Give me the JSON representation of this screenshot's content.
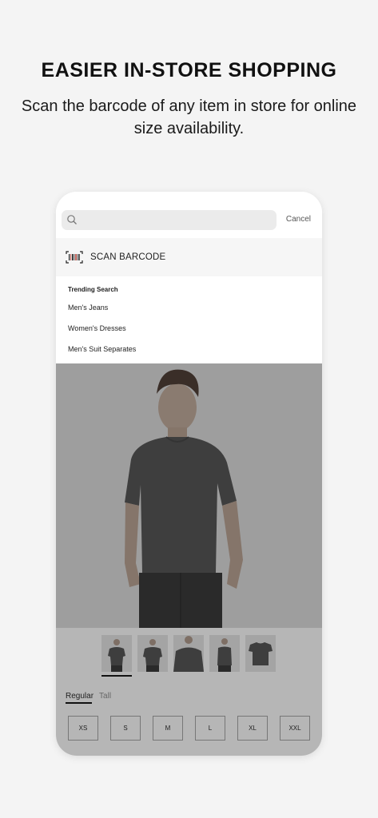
{
  "promo": {
    "headline": "EASIER IN-STORE SHOPPING",
    "subline": "Scan the barcode of any item in store for online size availability."
  },
  "search": {
    "placeholder": "",
    "cancel_label": "Cancel"
  },
  "scan": {
    "label": "SCAN BARCODE"
  },
  "trending": {
    "title": "Trending Search",
    "items": [
      "Men's Jeans",
      "Women's Dresses",
      "Men's Suit Separates"
    ]
  },
  "product": {
    "fit_tabs": [
      "Regular",
      "Tall"
    ],
    "selected_fit": "Regular",
    "sizes": [
      "XS",
      "S",
      "M",
      "L",
      "XL",
      "XXL"
    ]
  },
  "colors": {
    "background": "#f4f4f4",
    "overlay": "#b6b6b6",
    "shirt": "#3e3e3e"
  }
}
